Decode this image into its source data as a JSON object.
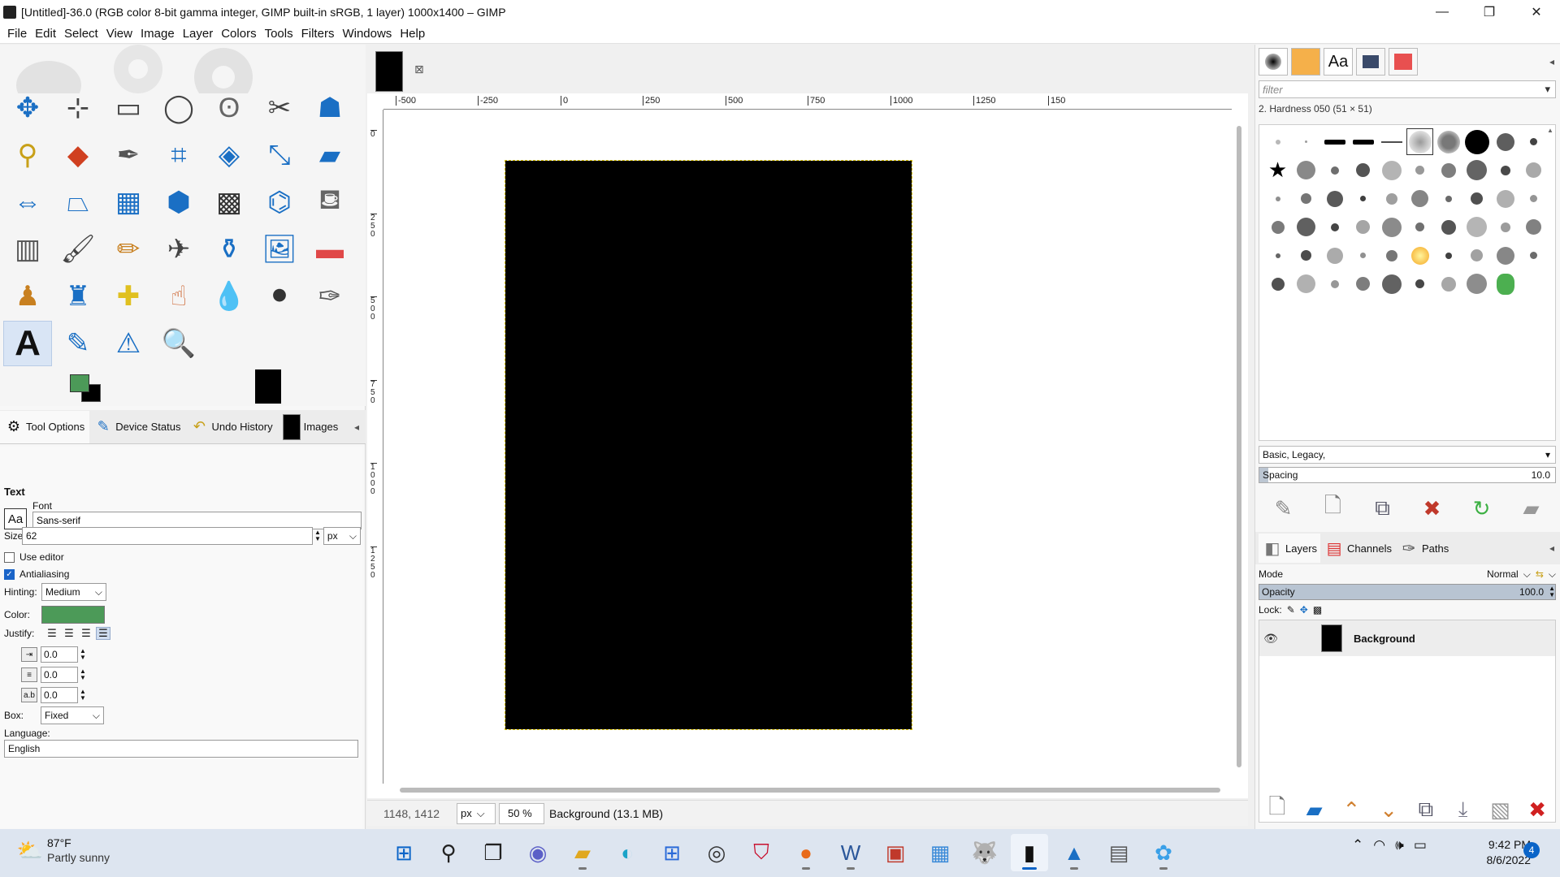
{
  "window": {
    "title": "[Untitled]-36.0 (RGB color 8-bit gamma integer, GIMP built-in sRGB, 1 layer) 1000x1400 – GIMP",
    "minimize": "—",
    "restore": "❐",
    "close": "✕"
  },
  "menu": [
    "File",
    "Edit",
    "Select",
    "View",
    "Image",
    "Layer",
    "Colors",
    "Tools",
    "Filters",
    "Windows",
    "Help"
  ],
  "toolbox": {
    "tools": [
      {
        "name": "move-tool-icon",
        "glyph": "✥",
        "color": "#1a6fc4"
      },
      {
        "name": "alignment-tool-icon",
        "glyph": "⊹",
        "color": "#444"
      },
      {
        "name": "rect-select-tool-icon",
        "glyph": "▭",
        "color": "#444"
      },
      {
        "name": "ellipse-select-tool-icon",
        "glyph": "◯",
        "color": "#444"
      },
      {
        "name": "free-select-tool-icon",
        "glyph": "ʘ",
        "color": "#666"
      },
      {
        "name": "scissors-select-tool-icon",
        "glyph": "✂",
        "color": "#444"
      },
      {
        "name": "foreground-select-tool-icon",
        "glyph": "☗",
        "color": "#1a6fc4"
      },
      {
        "name": "fuzzy-select-tool-icon",
        "glyph": "⚲",
        "color": "#c8a018"
      },
      {
        "name": "color-select-tool-icon",
        "glyph": "◆",
        "color": "#d04020"
      },
      {
        "name": "paths-tool-icon",
        "glyph": "✒",
        "color": "#555"
      },
      {
        "name": "crop-tool-icon",
        "glyph": "⌗",
        "color": "#1a6fc4"
      },
      {
        "name": "unified-transform-tool-icon",
        "glyph": "◈",
        "color": "#1a6fc4"
      },
      {
        "name": "scale-tool-icon",
        "glyph": "⤡",
        "color": "#1a6fc4"
      },
      {
        "name": "shear-tool-icon",
        "glyph": "▰",
        "color": "#1a6fc4"
      },
      {
        "name": "flip-tool-icon",
        "glyph": "⇔",
        "color": "#1a6fc4"
      },
      {
        "name": "perspective-tool-icon",
        "glyph": "⏢",
        "color": "#1a6fc4"
      },
      {
        "name": "3d-transform-tool-icon",
        "glyph": "▦",
        "color": "#1a6fc4"
      },
      {
        "name": "cage-transform-tool-icon",
        "glyph": "⬢",
        "color": "#1a6fc4"
      },
      {
        "name": "warp-transform-tool-icon",
        "glyph": "▩",
        "color": "#333"
      },
      {
        "name": "handle-transform-tool-icon",
        "glyph": "⌬",
        "color": "#1a6fc4"
      },
      {
        "name": "bucket-fill-tool-icon",
        "glyph": "⛾",
        "color": "#666"
      },
      {
        "name": "gradient-tool-icon",
        "glyph": "▥",
        "color": "#555"
      },
      {
        "name": "paintbrush-tool-icon",
        "glyph": "🖌",
        "color": "#444"
      },
      {
        "name": "pencil-tool-icon",
        "glyph": "✏",
        "color": "#c88020"
      },
      {
        "name": "airbrush-tool-icon",
        "glyph": "✈",
        "color": "#444"
      },
      {
        "name": "ink-tool-icon",
        "glyph": "⚱",
        "color": "#1a6fc4"
      },
      {
        "name": "mypaint-brush-tool-icon",
        "glyph": "🖼",
        "color": "#1a6fc4"
      },
      {
        "name": "eraser-tool-icon",
        "glyph": "▬",
        "color": "#e04848"
      },
      {
        "name": "clone-tool-icon",
        "glyph": "♟",
        "color": "#c88020"
      },
      {
        "name": "perspective-clone-tool-icon",
        "glyph": "♜",
        "color": "#1a6fc4"
      },
      {
        "name": "heal-tool-icon",
        "glyph": "✚",
        "color": "#e0c020"
      },
      {
        "name": "smudge-tool-icon",
        "glyph": "☝",
        "color": "#d07040"
      },
      {
        "name": "blur-sharpen-tool-icon",
        "glyph": "💧",
        "color": "#1a6fc4"
      },
      {
        "name": "dodge-burn-tool-icon",
        "glyph": "⚫",
        "color": "#333"
      },
      {
        "name": "paths-edit-tool-icon",
        "glyph": "✑",
        "color": "#555"
      },
      {
        "name": "text-tool-icon",
        "glyph": "A",
        "color": "#111"
      },
      {
        "name": "color-picker-tool-icon",
        "glyph": "✎",
        "color": "#1a6fc4"
      },
      {
        "name": "measure-tool-icon",
        "glyph": "⚠",
        "color": "#1a6fc4"
      },
      {
        "name": "zoom-tool-icon",
        "glyph": "🔍",
        "color": "#1a6fc4"
      }
    ]
  },
  "dock_tabs": [
    {
      "name": "tab-tool-options",
      "label": "Tool Options",
      "glyph": "⚙"
    },
    {
      "name": "tab-device-status",
      "label": "Device Status",
      "glyph": "✎"
    },
    {
      "name": "tab-undo-history",
      "label": "Undo History",
      "glyph": "↶"
    },
    {
      "name": "tab-images",
      "label": "Images",
      "glyph": ""
    }
  ],
  "tool_options": {
    "title": "Text",
    "font_label": "Font",
    "font_icon": "Aa",
    "font_value": "Sans-serif",
    "size_label": "Size:",
    "size_value": "62",
    "size_unit": "px",
    "use_editor": "Use editor",
    "antialiasing": "Antialiasing",
    "hinting_label": "Hinting:",
    "hinting_value": "Medium",
    "color_label": "Color:",
    "justify_label": "Justify:",
    "indent_value": "0.0",
    "line_spacing_value": "0.0",
    "letter_spacing_value": "0.0",
    "box_label": "Box:",
    "box_value": "Fixed",
    "language_label": "Language:",
    "language_value": "English"
  },
  "rulers": {
    "h": [
      "-500",
      "-250",
      "0",
      "250",
      "500",
      "750",
      "1000",
      "1250",
      "150"
    ],
    "v": [
      "0",
      "250",
      "500",
      "750",
      "1000",
      "1250"
    ]
  },
  "status": {
    "coords": "1148, 1412",
    "unit": "px",
    "zoom": "50 %",
    "message": "Background (13.1 MB)"
  },
  "brushes": {
    "filter_placeholder": "filter",
    "selected_name": "2. Hardness 050 (51 × 51)",
    "tags": "Basic, Legacy,",
    "spacing_label": "Spacing",
    "spacing_value": "10.0"
  },
  "layers_tabs": [
    {
      "name": "tab-layers",
      "label": "Layers"
    },
    {
      "name": "tab-channels",
      "label": "Channels"
    },
    {
      "name": "tab-paths",
      "label": "Paths"
    }
  ],
  "layers": {
    "mode_label": "Mode",
    "mode_value": "Normal",
    "opacity_label": "Opacity",
    "opacity_value": "100.0",
    "lock_label": "Lock:",
    "items": [
      {
        "name": "Background"
      }
    ]
  },
  "taskbar": {
    "temperature": "87°F",
    "condition": "Partly sunny",
    "time": "9:42 PM",
    "date": "8/6/2022",
    "notifications": "4"
  },
  "colors": {
    "foreground": "#4c9a58",
    "background": "#000000",
    "accent": "#0a64c8"
  }
}
